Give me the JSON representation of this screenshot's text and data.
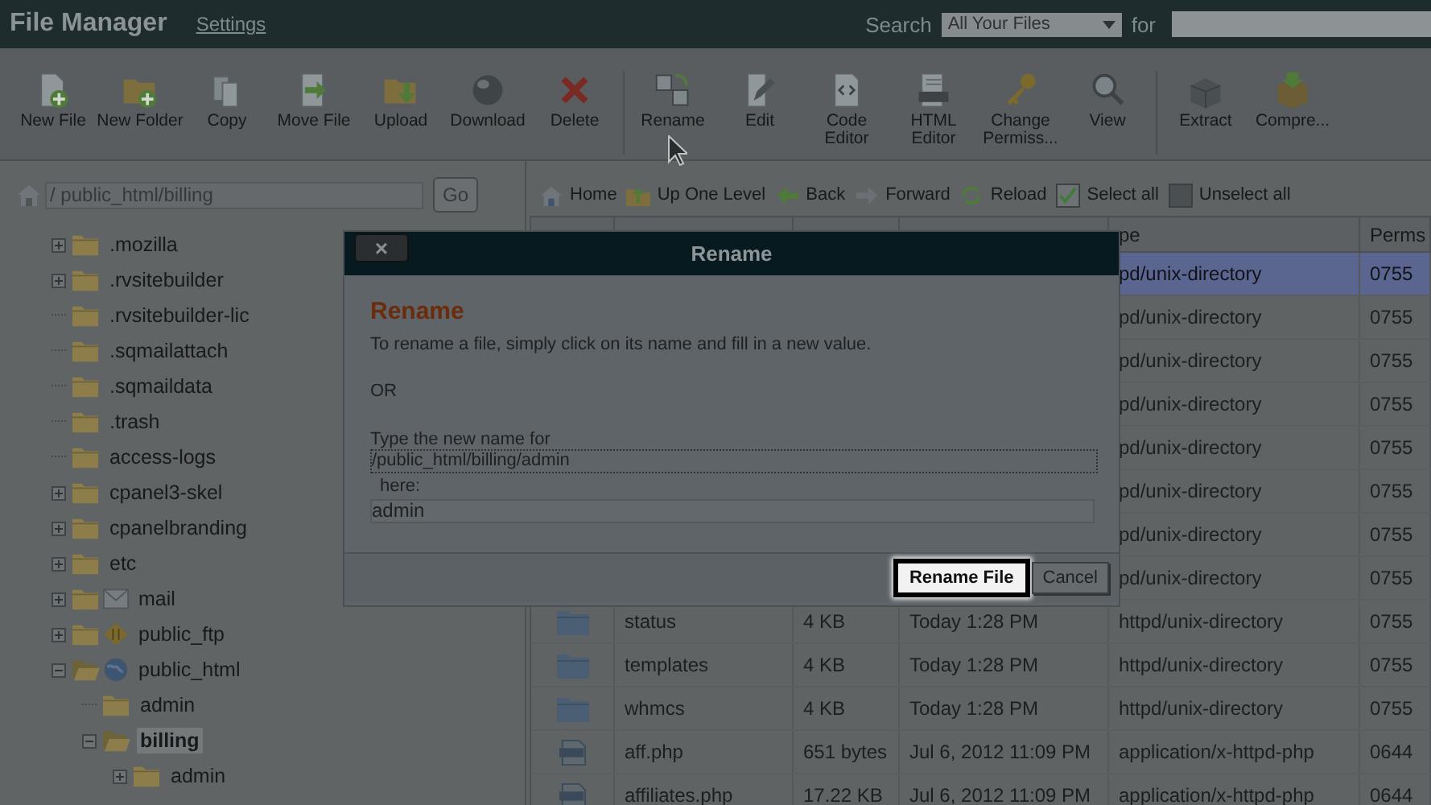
{
  "header": {
    "title": "File Manager",
    "settings": "Settings",
    "search_label": "Search",
    "search_scope": "All Your Files",
    "for_label": "for"
  },
  "toolbar": [
    [
      {
        "kind": "new-file",
        "label": "New File"
      },
      {
        "kind": "new-folder",
        "label": "New Folder"
      },
      {
        "kind": "copy",
        "label": "Copy"
      },
      {
        "kind": "move",
        "label": "Move File"
      },
      {
        "kind": "upload",
        "label": "Upload"
      },
      {
        "kind": "download",
        "label": "Download"
      },
      {
        "kind": "delete",
        "label": "Delete"
      }
    ],
    [
      {
        "kind": "rename",
        "label": "Rename"
      },
      {
        "kind": "edit",
        "label": "Edit"
      },
      {
        "kind": "code",
        "label": "Code Editor"
      },
      {
        "kind": "html",
        "label": "HTML Editor"
      },
      {
        "kind": "perms",
        "label": "Change Permiss..."
      },
      {
        "kind": "view",
        "label": "View"
      }
    ],
    [
      {
        "kind": "extract",
        "label": "Extract"
      },
      {
        "kind": "compress",
        "label": "Compre..."
      }
    ]
  ],
  "path": {
    "value": "/ public_html/billing",
    "go": "Go"
  },
  "tree": [
    {
      "kind": "folder",
      "label": ".mozilla",
      "expandable": true,
      "expanded": false,
      "selected": false
    },
    {
      "kind": "folder",
      "label": ".rvsitebuilder",
      "expandable": true,
      "expanded": false,
      "selected": false
    },
    {
      "kind": "folder",
      "label": ".rvsitebuilder-lic",
      "expandable": false,
      "expanded": false,
      "selected": false
    },
    {
      "kind": "folder",
      "label": ".sqmailattach",
      "expandable": false,
      "expanded": false,
      "selected": false
    },
    {
      "kind": "folder",
      "label": ".sqmaildata",
      "expandable": false,
      "expanded": false,
      "selected": false
    },
    {
      "kind": "folder",
      "label": ".trash",
      "expandable": false,
      "expanded": false,
      "selected": false
    },
    {
      "kind": "folder",
      "label": "access-logs",
      "expandable": false,
      "expanded": false,
      "selected": false
    },
    {
      "kind": "folder",
      "label": "cpanel3-skel",
      "expandable": true,
      "expanded": false,
      "selected": false
    },
    {
      "kind": "folder",
      "label": "cpanelbranding",
      "expandable": true,
      "expanded": false,
      "selected": false
    },
    {
      "kind": "folder",
      "label": "etc",
      "expandable": true,
      "expanded": false,
      "selected": false
    },
    {
      "kind": "mail",
      "label": "mail",
      "expandable": true,
      "expanded": false,
      "selected": false
    },
    {
      "kind": "ftp",
      "label": "public_ftp",
      "expandable": true,
      "expanded": false,
      "selected": false
    },
    {
      "kind": "web",
      "label": "public_html",
      "expandable": true,
      "expanded": true,
      "selected": false,
      "children": [
        {
          "kind": "folder",
          "label": "admin",
          "expandable": false,
          "expanded": false,
          "selected": false
        },
        {
          "kind": "folder",
          "label": "billing",
          "expandable": true,
          "expanded": true,
          "selected": true,
          "children": [
            {
              "kind": "folder",
              "label": "admin",
              "expandable": true,
              "expanded": false,
              "selected": false
            }
          ]
        }
      ]
    }
  ],
  "nav": [
    {
      "kind": "home",
      "label": "Home"
    },
    {
      "kind": "up",
      "label": "Up One Level"
    },
    {
      "kind": "back",
      "label": "Back"
    },
    {
      "kind": "forward",
      "label": "Forward"
    },
    {
      "kind": "reload",
      "label": "Reload"
    },
    {
      "kind": "checkbox",
      "label": "Select all",
      "checked": true
    },
    {
      "kind": "checkbox",
      "label": "Unselect all",
      "checked": false
    }
  ],
  "table": {
    "columns": [
      {
        "label": "pe"
      },
      {
        "label": "Perms"
      }
    ],
    "rows": [
      {
        "type": "pd/unix-directory",
        "perms": "0755",
        "selected": true
      },
      {
        "type": "pd/unix-directory",
        "perms": "0755",
        "selected": false
      },
      {
        "type": "pd/unix-directory",
        "perms": "0755",
        "selected": false
      },
      {
        "type": "pd/unix-directory",
        "perms": "0755",
        "selected": false
      },
      {
        "type": "pd/unix-directory",
        "perms": "0755",
        "selected": false
      },
      {
        "type": "pd/unix-directory",
        "perms": "0755",
        "selected": false
      },
      {
        "type": "pd/unix-directory",
        "perms": "0755",
        "selected": false
      },
      {
        "type": "pd/unix-directory",
        "perms": "0755",
        "selected": false
      },
      {
        "kind": "folder",
        "name": "status",
        "size": "4 KB",
        "modified": "Today 1:28 PM",
        "type": "httpd/unix-directory",
        "perms": "0755",
        "selected": false
      },
      {
        "kind": "folder",
        "name": "templates",
        "size": "4 KB",
        "modified": "Today 1:28 PM",
        "type": "httpd/unix-directory",
        "perms": "0755",
        "selected": false
      },
      {
        "kind": "folder",
        "name": "whmcs",
        "size": "4 KB",
        "modified": "Today 1:28 PM",
        "type": "httpd/unix-directory",
        "perms": "0755",
        "selected": false
      },
      {
        "kind": "php",
        "name": "aff.php",
        "size": "651 bytes",
        "modified": "Jul 6, 2012 11:09 PM",
        "type": "application/x-httpd-php",
        "perms": "0644",
        "selected": false
      },
      {
        "kind": "php",
        "name": "affiliates.php",
        "size": "17.22 KB",
        "modified": "Jul 6, 2012 11:09 PM",
        "type": "application/x-httpd-php",
        "perms": "0644",
        "selected": false
      }
    ]
  },
  "dialog": {
    "close": "×",
    "title": "Rename",
    "heading": "Rename",
    "instructions": "To rename a file, simply click on its name and fill in a new value.",
    "or": "OR",
    "prompt": "Type the new name for",
    "current_path": "/public_html/billing/admin",
    "here": "here:",
    "new_name": "admin",
    "buttons": [
      {
        "label": "Rename File",
        "focused": true
      },
      {
        "label": "Cancel",
        "focused": false
      }
    ]
  }
}
